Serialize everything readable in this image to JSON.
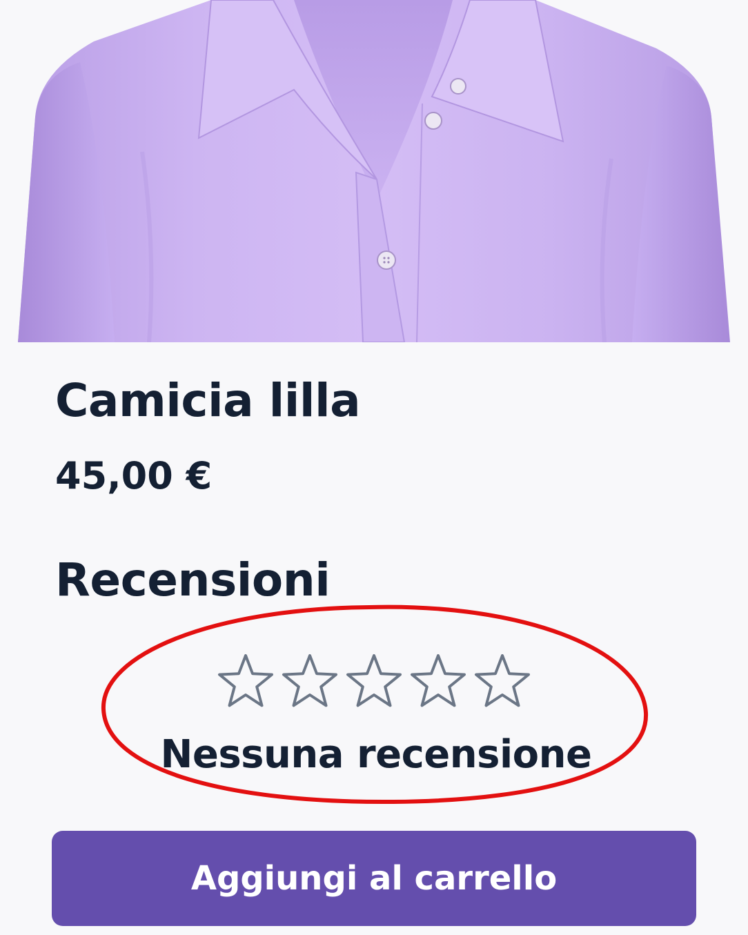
{
  "product": {
    "image_alt": "camicia lilla",
    "image_icon": "lilac-shirt-photo",
    "title": "Camicia lilla",
    "price": "45,00 €"
  },
  "reviews": {
    "heading": "Recensioni",
    "star_icon": "star-outline-icon",
    "rating": 0,
    "max_rating": 5,
    "empty_text": "Nessuna recensione"
  },
  "cart": {
    "add_label": "Aggiungi al carrello"
  },
  "colors": {
    "background": "#f8f8fa",
    "text": "#142033",
    "accent": "#644ead",
    "shirt": "#c9aff0",
    "star_outline": "#6b7686",
    "highlight": "#e31010"
  }
}
